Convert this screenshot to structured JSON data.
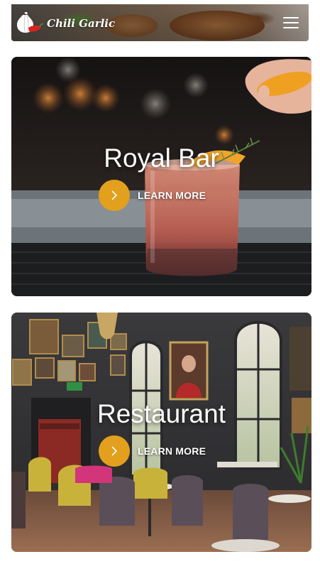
{
  "header": {
    "brand": "Chili Garlic",
    "logo_icon": "garlic-chili-logo",
    "menu_icon": "hamburger-menu-icon"
  },
  "cards": [
    {
      "title": "Royal Bar",
      "cta_label": "LEARN MORE",
      "cta_icon": "chevron-right-icon",
      "image": "cocktail-photo"
    },
    {
      "title": "Restaurant",
      "cta_label": "LEARN MORE",
      "cta_icon": "chevron-right-icon",
      "image": "restaurant-interior-photo"
    }
  ],
  "colors": {
    "accent": "#e3a01c",
    "text_on_image": "#ffffff",
    "page_background": "#ffffff"
  }
}
